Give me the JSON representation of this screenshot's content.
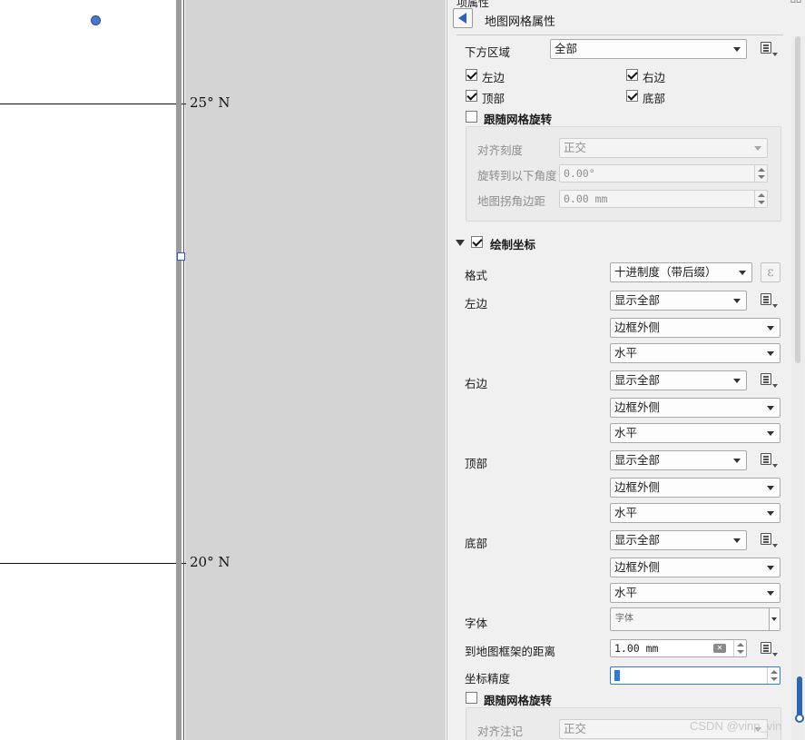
{
  "map": {
    "lat_labels": [
      "25° N",
      "20° N"
    ]
  },
  "panel": {
    "title": "项属性",
    "header": "地图网格属性",
    "lower_area_label": "下方区域",
    "lower_area_value": "全部",
    "sides": {
      "left": "左边",
      "right": "右边",
      "top": "顶部",
      "bottom": "底部"
    },
    "follow_rotation": "跟随网格旋转",
    "rotation_group": {
      "align_tick_label": "对齐刻度",
      "align_tick_value": "正交",
      "rotate_label": "旋转到以下角度",
      "rotate_value": "0.00°",
      "corner_margin_label": "地图拐角边距",
      "corner_margin_value": "0.00 mm"
    },
    "draw_coords": "绘制坐标",
    "format_label": "格式",
    "format_value": "十进制度（带后缀）",
    "epsilon": "ε",
    "side_settings": {
      "show_all": "显示全部",
      "outside": "边框外侧",
      "horizontal": "水平"
    },
    "font_label": "字体",
    "font_value": "字体",
    "distance_label": "到地图框架的距离",
    "distance_value": "1.00 mm",
    "precision_label": "坐标精度",
    "precision_value": "0",
    "follow_rotation_2": "跟随网格旋转",
    "align_annot_label": "对齐注记",
    "align_annot_value": "正交"
  },
  "watermark": "CSDN @vinp_vin",
  "colors": {
    "accent": "#2e64b5",
    "panel_bg": "#f0f0f0",
    "canvas_gray": "#d4d4d4"
  }
}
